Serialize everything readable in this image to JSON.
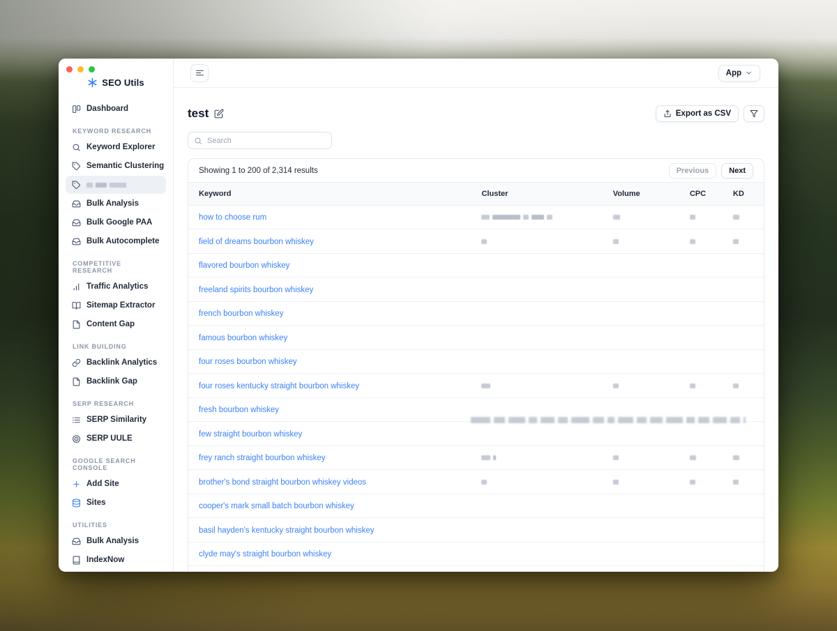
{
  "colors": {
    "accent": "#3b82f6",
    "link": "#3b82f6",
    "redaction": "#c6cbd6",
    "traffic_red": "#ff5f57",
    "traffic_yellow": "#febc2e",
    "traffic_green": "#28c840"
  },
  "sidebar": {
    "brand": "SEO Utils",
    "sections": [
      {
        "items": [
          {
            "icon": "dashboard-icon",
            "label": "Dashboard"
          }
        ]
      },
      {
        "header": "KEYWORD RESEARCH",
        "items": [
          {
            "icon": "search-icon",
            "label": "Keyword Explorer"
          },
          {
            "icon": "tag-icon",
            "label": "Semantic Clustering"
          },
          {
            "icon": "tag-icon",
            "redacted": true,
            "redacted_blocks": [
              9,
              16,
              24
            ],
            "active": true
          },
          {
            "icon": "inbox-icon",
            "label": "Bulk Analysis"
          },
          {
            "icon": "inbox-icon",
            "label": "Bulk Google PAA"
          },
          {
            "icon": "inbox-icon",
            "label": "Bulk Autocomplete"
          }
        ]
      },
      {
        "header": "COMPETITIVE RESEARCH",
        "items": [
          {
            "icon": "bar-chart-icon",
            "label": "Traffic Analytics"
          },
          {
            "icon": "book-open-icon",
            "label": "Sitemap Extractor"
          },
          {
            "icon": "file-icon",
            "label": "Content Gap"
          }
        ]
      },
      {
        "header": "LINK BUILDING",
        "items": [
          {
            "icon": "link-icon",
            "label": "Backlink Analytics"
          },
          {
            "icon": "file-icon",
            "label": "Backlink Gap"
          }
        ]
      },
      {
        "header": "SERP RESEARCH",
        "items": [
          {
            "icon": "list-icon",
            "label": "SERP Similarity"
          },
          {
            "icon": "target-icon",
            "label": "SERP UULE"
          }
        ]
      },
      {
        "header": "GOOGLE SEARCH CONSOLE",
        "items": [
          {
            "icon": "plus-icon",
            "label": "Add Site",
            "accent": true
          },
          {
            "icon": "database-icon",
            "label": "Sites",
            "accent": true
          }
        ]
      },
      {
        "header": "UTILITIES",
        "items": [
          {
            "icon": "inbox-icon",
            "label": "Bulk Analysis"
          },
          {
            "icon": "book-icon",
            "label": "IndexNow"
          }
        ]
      }
    ]
  },
  "topbar": {
    "app_label": "App"
  },
  "page": {
    "title": "test",
    "export_label": "Export as CSV",
    "search_placeholder": "Search"
  },
  "table": {
    "summary": "Showing 1 to 200 of 2,314 results",
    "pagination": {
      "previous": "Previous",
      "next": "Next"
    },
    "columns": [
      "Keyword",
      "Cluster",
      "Volume",
      "CPC",
      "KD"
    ],
    "rows": [
      {
        "keyword": "how to choose rum",
        "cluster_blocks": [
          12,
          40,
          8,
          18,
          8
        ],
        "volume_block": 10,
        "cpc_block": 8,
        "kd_block": 9
      },
      {
        "keyword": "field of dreams bourbon whiskey",
        "cluster_blocks": [
          8
        ],
        "volume_block": 8,
        "cpc_block": 8,
        "kd_block": 8
      },
      {
        "keyword": "flavored bourbon whiskey"
      },
      {
        "keyword": "freeland spirits bourbon whiskey"
      },
      {
        "keyword": "french bourbon whiskey"
      },
      {
        "keyword": "famous bourbon whiskey"
      },
      {
        "keyword": "four roses bourbon whiskey"
      },
      {
        "keyword": "four roses kentucky straight bourbon whiskey",
        "cluster_blocks": [
          13
        ],
        "volume_block": 8,
        "cpc_block": 8,
        "kd_block": 8
      },
      {
        "keyword": "fresh bourbon whiskey"
      },
      {
        "keyword": "few straight bourbon whiskey"
      },
      {
        "keyword": "frey ranch straight bourbon whiskey",
        "cluster_blocks": [
          13,
          4
        ],
        "volume_block": 8,
        "cpc_block": 9,
        "kd_block": 9
      },
      {
        "keyword": "brother's bond straight bourbon whiskey videos",
        "cluster_blocks": [
          8
        ],
        "volume_block": 8,
        "cpc_block": 8,
        "kd_block": 8
      },
      {
        "keyword": "cooper's mark small batch bourbon whiskey"
      },
      {
        "keyword": "basil hayden's kentucky straight bourbon whiskey"
      },
      {
        "keyword": "clyde may's straight bourbon whiskey"
      }
    ],
    "redaction_strip": [
      28,
      16,
      24,
      12,
      20,
      14,
      26,
      16,
      10,
      22,
      14,
      18,
      24,
      12,
      16,
      20,
      14,
      10
    ]
  }
}
